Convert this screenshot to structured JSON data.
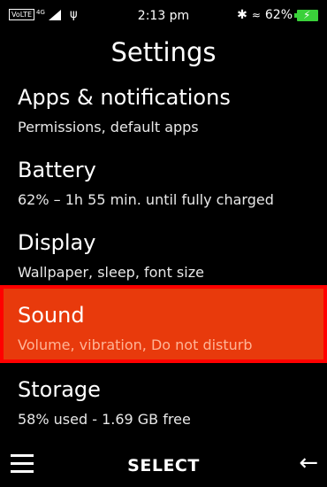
{
  "status_bar": {
    "volte": "VoLTE",
    "network": "4G",
    "time": "2:13 pm",
    "battery_percent": "62%",
    "icons": [
      "volte-icon",
      "signal-icon",
      "usb-icon",
      "bluetooth-icon",
      "wifi-icon",
      "battery-charging-icon"
    ]
  },
  "header": {
    "title": "Settings"
  },
  "items": [
    {
      "title": "Apps & notifications",
      "subtitle": "Permissions, default apps"
    },
    {
      "title": "Battery",
      "subtitle": "62% – 1h 55 min. until fully charged"
    },
    {
      "title": "Display",
      "subtitle": "Wallpaper, sleep, font size"
    },
    {
      "title": "Sound",
      "subtitle": "Volume, vibration, Do not disturb"
    },
    {
      "title": "Storage",
      "subtitle": "58% used - 1.69 GB free"
    }
  ],
  "selected_index": 3,
  "softkeys": {
    "left_icon": "menu-icon",
    "center_label": "SELECT",
    "right_icon": "back-arrow-icon"
  },
  "colors": {
    "background": "#000000",
    "selected_fill": "#e83a0c",
    "selected_outline": "#ff0000",
    "battery": "#3ad13a"
  }
}
